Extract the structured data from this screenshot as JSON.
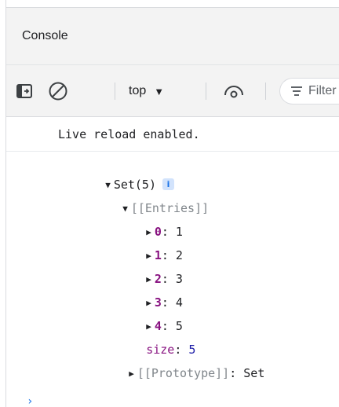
{
  "panel": {
    "title": "Console"
  },
  "toolbar": {
    "sidebar_icon": "sidebar-toggle-icon",
    "clear_icon": "clear-console-icon",
    "context_label": "top",
    "eye_icon": "live-expression-icon",
    "filter_placeholder": "Filter"
  },
  "console": {
    "log_message": "Live reload enabled.",
    "set_header": "Set(5)",
    "info_badge": "i",
    "entries_label": "[[Entries]]",
    "entries": [
      {
        "index": "0",
        "value": "1"
      },
      {
        "index": "1",
        "value": "2"
      },
      {
        "index": "2",
        "value": "3"
      },
      {
        "index": "3",
        "value": "4"
      },
      {
        "index": "4",
        "value": "5"
      }
    ],
    "size_key": "size",
    "size_value": "5",
    "prototype_label": "[[Prototype]]",
    "prototype_value": "Set"
  },
  "colors": {
    "key": "#881280",
    "number": "#1a1aa6",
    "internal": "#80868b",
    "accent": "#1a73e8"
  }
}
